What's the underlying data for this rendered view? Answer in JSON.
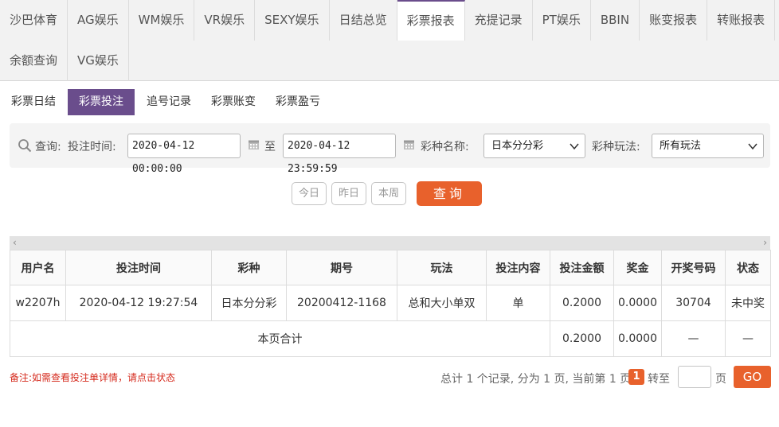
{
  "topnav": {
    "row1": [
      "沙巴体育",
      "AG娱乐",
      "WM娱乐",
      "VR娱乐",
      "SEXY娱乐",
      "日结总览",
      "彩票报表",
      "充提记录",
      "PT娱乐",
      "BBIN",
      "账变报表",
      "转账报表"
    ],
    "row2": [
      "余额查询",
      "VG娱乐"
    ],
    "active": "彩票报表"
  },
  "subtabs": [
    "彩票日结",
    "彩票投注",
    "追号记录",
    "彩票账变",
    "彩票盈亏"
  ],
  "subtab_active": "彩票投注",
  "filter": {
    "query_label": "查询:",
    "time_label": "投注时间:",
    "start": "2020-04-12 00:00:00",
    "to": "至",
    "end": "2020-04-12 23:59:59",
    "lottery_label": "彩种名称:",
    "lottery_value": "日本分分彩",
    "play_label": "彩种玩法:",
    "play_value": "所有玩法"
  },
  "quick": [
    "今日",
    "昨日",
    "本周"
  ],
  "query_button": "查询",
  "table": {
    "headers": [
      "用户名",
      "投注时间",
      "彩种",
      "期号",
      "玩法",
      "投注内容",
      "投注金额",
      "奖金",
      "开奖号码",
      "状态"
    ],
    "row": [
      "w2207h",
      "2020-04-12 19:27:54",
      "日本分分彩",
      "20200412-1168",
      "总和大小单双",
      "单",
      "0.2000",
      "0.0000",
      "30704",
      "未中奖"
    ],
    "summary": {
      "label": "本页合计",
      "amount": "0.2000",
      "prize": "0.0000",
      "draw": "—",
      "status": "—"
    }
  },
  "note": "备注:如需查看投注单详情，请点击状态",
  "pager": {
    "summary": "总计 1 个记录, 分为 1 页, 当前第 1 页",
    "current": "1",
    "goto": "转至",
    "page": "页",
    "go": "GO"
  },
  "colors": {
    "accent": "#6a4d8c",
    "orange": "#e8612c",
    "note": "#d52b1e"
  }
}
